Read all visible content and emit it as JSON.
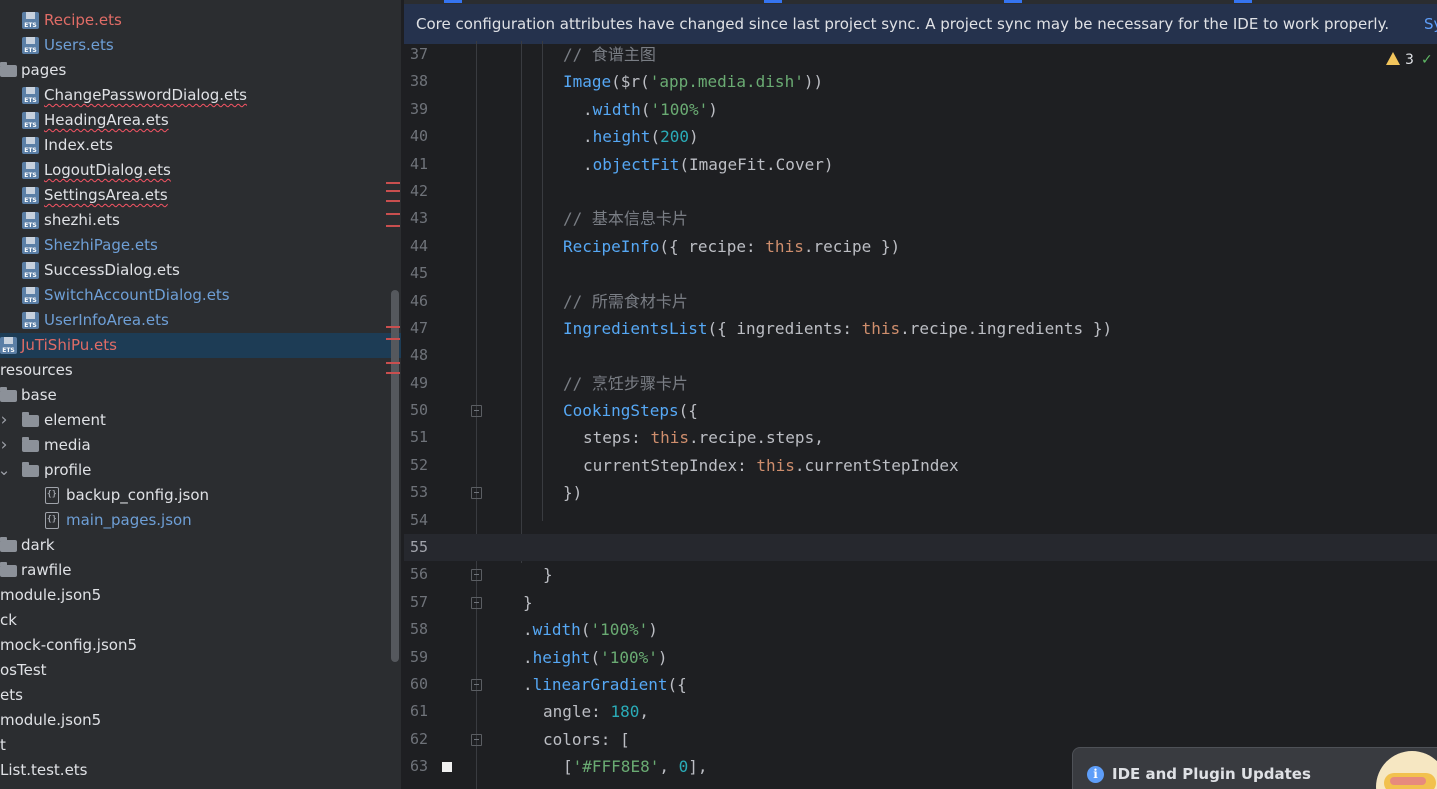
{
  "project_tree": {
    "items": [
      {
        "label": "Recipe.ets",
        "icon": "ets-file-icon",
        "color": "red",
        "indent": 2,
        "underline": false
      },
      {
        "label": "Users.ets",
        "icon": "ets-file-icon",
        "color": "blue",
        "indent": 2,
        "underline": false
      },
      {
        "label": "pages",
        "icon": "folder-icon",
        "color": "normal",
        "indent": 1,
        "underline": false
      },
      {
        "label": "ChangePasswordDialog.ets",
        "icon": "ets-file-icon",
        "color": "normal",
        "indent": 2,
        "underline": true
      },
      {
        "label": "HeadingArea.ets",
        "icon": "ets-file-icon",
        "color": "normal",
        "indent": 2,
        "underline": true
      },
      {
        "label": "Index.ets",
        "icon": "ets-file-icon",
        "color": "normal",
        "indent": 2,
        "underline": false
      },
      {
        "label": "LogoutDialog.ets",
        "icon": "ets-file-icon",
        "color": "normal",
        "indent": 2,
        "underline": true
      },
      {
        "label": "SettingsArea.ets",
        "icon": "ets-file-icon",
        "color": "normal",
        "indent": 2,
        "underline": true
      },
      {
        "label": "shezhi.ets",
        "icon": "ets-file-icon",
        "color": "normal",
        "indent": 2,
        "underline": false
      },
      {
        "label": "ShezhiPage.ets",
        "icon": "ets-file-icon",
        "color": "blue",
        "indent": 2,
        "underline": false
      },
      {
        "label": "SuccessDialog.ets",
        "icon": "ets-file-icon",
        "color": "normal",
        "indent": 2,
        "underline": false
      },
      {
        "label": "SwitchAccountDialog.ets",
        "icon": "ets-file-icon",
        "color": "blue",
        "indent": 2,
        "underline": false
      },
      {
        "label": "UserInfoArea.ets",
        "icon": "ets-file-icon",
        "color": "blue",
        "indent": 2,
        "underline": false
      },
      {
        "label": "JuTiShiPu.ets",
        "icon": "ets-file-icon",
        "color": "red",
        "indent": 1,
        "underline": false,
        "selected": true
      },
      {
        "label": "resources",
        "icon": "none",
        "color": "normal",
        "indent": 0,
        "underline": false
      },
      {
        "label": "base",
        "icon": "folder-icon",
        "color": "normal",
        "indent": 1,
        "underline": false
      },
      {
        "label": "element",
        "icon": "folder-icon",
        "color": "normal",
        "indent": 2,
        "underline": false,
        "chevron": "right"
      },
      {
        "label": "media",
        "icon": "folder-icon",
        "color": "normal",
        "indent": 2,
        "underline": false,
        "chevron": "right"
      },
      {
        "label": "profile",
        "icon": "folder-icon",
        "color": "normal",
        "indent": 2,
        "underline": false,
        "chevron": "down"
      },
      {
        "label": "backup_config.json",
        "icon": "json-file-icon",
        "color": "normal",
        "indent": 3,
        "underline": false
      },
      {
        "label": "main_pages.json",
        "icon": "json-file-icon",
        "color": "blue",
        "indent": 3,
        "underline": false
      },
      {
        "label": "dark",
        "icon": "folder-icon",
        "color": "normal",
        "indent": 1,
        "underline": false
      },
      {
        "label": "rawfile",
        "icon": "folder-icon",
        "color": "normal",
        "indent": 1,
        "underline": false
      },
      {
        "label": "module.json5",
        "icon": "none",
        "color": "normal",
        "indent": 0,
        "underline": false
      },
      {
        "label": "ck",
        "icon": "none",
        "color": "normal",
        "indent": 0,
        "underline": false
      },
      {
        "label": "mock-config.json5",
        "icon": "none",
        "color": "normal",
        "indent": 0,
        "underline": false
      },
      {
        "label": "osTest",
        "icon": "none",
        "color": "normal",
        "indent": 0,
        "underline": false
      },
      {
        "label": "ets",
        "icon": "none",
        "color": "normal",
        "indent": 0,
        "underline": false
      },
      {
        "label": "module.json5",
        "icon": "none",
        "color": "normal",
        "indent": 0,
        "underline": false
      },
      {
        "label": "t",
        "icon": "none",
        "color": "normal",
        "indent": 0,
        "underline": false
      },
      {
        "label": "List.test.ets",
        "icon": "none",
        "color": "normal",
        "indent": 0,
        "underline": false
      }
    ]
  },
  "colors": {
    "normal": "#dfe1e5",
    "red": "#e06c66",
    "blue": "#6e9fd6",
    "accent": "#3574f0",
    "error": "#c94f4f",
    "warning": "#f2c55c"
  },
  "banner": {
    "message": "Core configuration attributes have changed since last project sync. A project sync may be necessary for the IDE to work properly.",
    "link": "Sy"
  },
  "inspections": {
    "warning_count": "3",
    "warning_icon": "warning-triangle-icon",
    "ok_icon": "check-icon",
    "ok_glyph": "✓"
  },
  "editor": {
    "current_line": 55,
    "lines": [
      {
        "n": "37",
        "indent": 4,
        "tokens": [
          [
            "com",
            "// 食谱主图"
          ]
        ]
      },
      {
        "n": "38",
        "indent": 4,
        "tokens": [
          [
            "fn",
            "Image"
          ],
          [
            "id",
            "($r("
          ],
          [
            "str",
            "'app.media.dish'"
          ],
          [
            "id",
            "))"
          ]
        ]
      },
      {
        "n": "39",
        "indent": 5,
        "tokens": [
          [
            "id",
            "."
          ],
          [
            "fn",
            "width"
          ],
          [
            "id",
            "("
          ],
          [
            "str",
            "'100%'"
          ],
          [
            "id",
            ")"
          ]
        ]
      },
      {
        "n": "40",
        "indent": 5,
        "tokens": [
          [
            "id",
            "."
          ],
          [
            "fn",
            "height"
          ],
          [
            "id",
            "("
          ],
          [
            "num",
            "200"
          ],
          [
            "id",
            ")"
          ]
        ]
      },
      {
        "n": "41",
        "indent": 5,
        "tokens": [
          [
            "id",
            "."
          ],
          [
            "fn",
            "objectFit"
          ],
          [
            "id",
            "(ImageFit.Cover)"
          ]
        ]
      },
      {
        "n": "42",
        "indent": 0,
        "tokens": []
      },
      {
        "n": "43",
        "indent": 4,
        "tokens": [
          [
            "com",
            "// 基本信息卡片"
          ]
        ]
      },
      {
        "n": "44",
        "indent": 4,
        "tokens": [
          [
            "fn",
            "RecipeInfo"
          ],
          [
            "id",
            "({ recipe: "
          ],
          [
            "kw",
            "this"
          ],
          [
            "id",
            ".recipe })"
          ]
        ]
      },
      {
        "n": "45",
        "indent": 0,
        "tokens": []
      },
      {
        "n": "46",
        "indent": 4,
        "tokens": [
          [
            "com",
            "// 所需食材卡片"
          ]
        ]
      },
      {
        "n": "47",
        "indent": 4,
        "tokens": [
          [
            "fn",
            "IngredientsList"
          ],
          [
            "id",
            "({ ingredients: "
          ],
          [
            "kw",
            "this"
          ],
          [
            "id",
            ".recipe.ingredients })"
          ]
        ]
      },
      {
        "n": "48",
        "indent": 0,
        "tokens": []
      },
      {
        "n": "49",
        "indent": 4,
        "tokens": [
          [
            "com",
            "// 烹饪步骤卡片"
          ]
        ]
      },
      {
        "n": "50",
        "indent": 4,
        "fold": true,
        "tokens": [
          [
            "fn",
            "CookingSteps"
          ],
          [
            "id",
            "({"
          ]
        ]
      },
      {
        "n": "51",
        "indent": 5,
        "tokens": [
          [
            "id",
            "steps: "
          ],
          [
            "kw",
            "this"
          ],
          [
            "id",
            ".recipe.steps,"
          ]
        ]
      },
      {
        "n": "52",
        "indent": 5,
        "tokens": [
          [
            "id",
            "currentStepIndex: "
          ],
          [
            "kw",
            "this"
          ],
          [
            "id",
            ".currentStepIndex"
          ]
        ]
      },
      {
        "n": "53",
        "indent": 4,
        "fold": true,
        "tokens": [
          [
            "id",
            "})"
          ]
        ]
      },
      {
        "n": "54",
        "indent": 0,
        "tokens": []
      },
      {
        "n": "55",
        "indent": 0,
        "tokens": []
      },
      {
        "n": "56",
        "indent": 3,
        "fold": true,
        "tokens": [
          [
            "id",
            "}"
          ]
        ]
      },
      {
        "n": "57",
        "indent": 2,
        "fold": true,
        "tokens": [
          [
            "id",
            "}"
          ]
        ]
      },
      {
        "n": "58",
        "indent": 2,
        "tokens": [
          [
            "id",
            "."
          ],
          [
            "fn",
            "width"
          ],
          [
            "id",
            "("
          ],
          [
            "str",
            "'100%'"
          ],
          [
            "id",
            ")"
          ]
        ]
      },
      {
        "n": "59",
        "indent": 2,
        "tokens": [
          [
            "id",
            "."
          ],
          [
            "fn",
            "height"
          ],
          [
            "id",
            "("
          ],
          [
            "str",
            "'100%'"
          ],
          [
            "id",
            ")"
          ]
        ]
      },
      {
        "n": "60",
        "indent": 2,
        "fold": true,
        "tokens": [
          [
            "id",
            "."
          ],
          [
            "fn",
            "linearGradient"
          ],
          [
            "id",
            "({"
          ]
        ]
      },
      {
        "n": "61",
        "indent": 3,
        "tokens": [
          [
            "id",
            "angle: "
          ],
          [
            "num",
            "180"
          ],
          [
            "id",
            ","
          ]
        ]
      },
      {
        "n": "62",
        "indent": 3,
        "fold": true,
        "tokens": [
          [
            "id",
            "colors: ["
          ]
        ]
      },
      {
        "n": "63",
        "indent": 4,
        "bookmark": true,
        "tokens": [
          [
            "id",
            "["
          ],
          [
            "str",
            "'#FFF8E8'"
          ],
          [
            "id",
            ", "
          ],
          [
            "num",
            "0"
          ],
          [
            "id",
            "],"
          ]
        ]
      }
    ]
  },
  "notification": {
    "title": "IDE and Plugin Updates",
    "icon": "info-icon",
    "info_glyph": "i"
  }
}
